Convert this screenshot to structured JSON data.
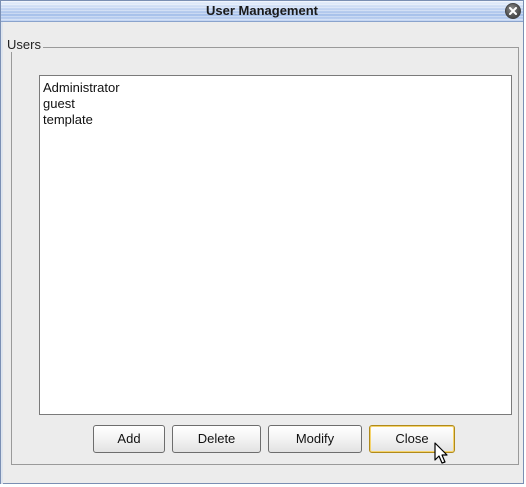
{
  "window": {
    "title": "User Management"
  },
  "users_group": {
    "label": "Users",
    "items": [
      "Administrator",
      "guest",
      "template"
    ]
  },
  "buttons": {
    "add": "Add",
    "delete": "Delete",
    "modify": "Modify",
    "close": "Close"
  },
  "icons": {
    "close": "close-icon",
    "cursor": "mouse-pointer-icon"
  }
}
